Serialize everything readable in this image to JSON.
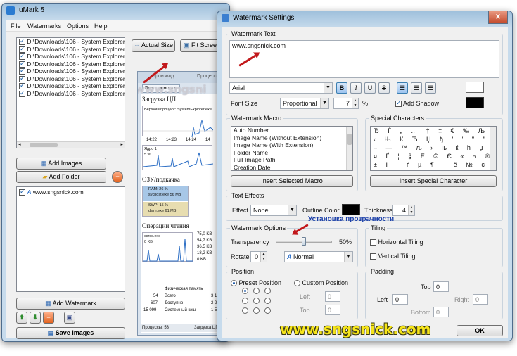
{
  "colors": {
    "accent": "#3c7fb1",
    "annotation_red": "#c2181b",
    "annotation_blue": "#1a3ea8",
    "watermark_yellow": "#f6e51b"
  },
  "umark": {
    "title": "uMark 5",
    "menu": [
      "File",
      "Watermarks",
      "Options",
      "Help"
    ],
    "files": [
      "D:\\Downloads\\106 - System Explorer 5",
      "D:\\Downloads\\106 - System Explorer 5",
      "D:\\Downloads\\106 - System Explorer 5",
      "D:\\Downloads\\106 - System Explorer 5",
      "D:\\Downloads\\106 - System Explorer 5",
      "D:\\Downloads\\106 - System Explorer 5",
      "D:\\Downloads\\106 - System Explorer 5",
      "D:\\Downloads\\106 - System Explorer 5"
    ],
    "actual_size": "Actual Size",
    "fit_screen": "Fit Screen",
    "add_images": "Add Images",
    "add_folder": "Add Folder",
    "watermark_item": "www.sngsnick.com",
    "add_watermark": "Add Watermark",
    "save_images": "Save Images"
  },
  "preview": {
    "tab_perf": "Производ",
    "tab_security": "Безопасность",
    "tab_processes": "Процесс",
    "cpu_title": "Загрузка ЦП",
    "top_process": "Верхний процесс: SystemExplorer.exe",
    "cpu_times": [
      "14:22",
      "14:23",
      "14:24",
      "14"
    ],
    "core_label": "Ядро 1",
    "core_pct": "5 %",
    "ram_title": "ОЗУ/подкачка",
    "ram_line": "RAM: 26 %",
    "ram_proc": "svchost.exe 56 MB",
    "swp_line": "SWP: 15 %",
    "swp_proc": "dwm.exe 61 MB",
    "read_title": "Операции чтения",
    "read_proc": "csrss.exe",
    "read_kb": "0 KB",
    "read_vals": [
      "75,0 KB",
      "54,7 KB",
      "36,5 KB",
      "18,2 KB",
      "0 KB"
    ],
    "phys_header": "Физическая память",
    "phys_rows": [
      {
        "num": "54",
        "label": "Всего",
        "val": "3 1"
      },
      {
        "num": "607",
        "label": "Доступно",
        "val": "2 2"
      },
      {
        "num": "15 099",
        "label": "Системный кэш",
        "val": "1 5"
      }
    ],
    "status_processes": "Процессы: 53",
    "status_load": "Загрузка ЦП"
  },
  "dialog": {
    "title": "Watermark Settings",
    "watermark_text_label": "Watermark Text",
    "watermark_text": "www.sngsnick.com",
    "font": "Arial",
    "fmt_bold": "B",
    "fmt_italic": "I",
    "fmt_underline": "U",
    "fmt_strike": "S",
    "font_size_label": "Font Size",
    "font_size_mode": "Proportional",
    "font_size_value": "7",
    "font_size_unit": "%",
    "add_shadow": "Add Shadow",
    "macro_label": "Watermark Macro",
    "macros": [
      "Auto Number",
      "Image Name (Without Extension)",
      "Image Name (With Extension)",
      "Folder Name",
      "Full Image Path",
      "Creation Date"
    ],
    "insert_macro": "Insert Selected Macro",
    "special_label": "Special Characters",
    "special_rows": [
      "Ђ Ѓ „ … † ‡ € ‰ Љ",
      "‹ Њ Ќ Ћ Џ ђ ' ' \" \" •",
      "– — ™ љ › њ ќ ћ џ Ў ў Ј",
      "¤ Ґ ¦ § Ё © Є « ¬ ® Ї °",
      "± І і ґ µ ¶ · ё № є » ј"
    ],
    "insert_special": "Insert Special Character",
    "text_effects_label": "Text Effects",
    "effect_label": "Effect",
    "effect_value": "None",
    "outline_color_label": "Outline Color",
    "thickness_label": "Thickness",
    "thickness_value": "4",
    "wm_options_label": "Watermark Options",
    "transparency_label": "Transparency",
    "transparency_pct": "50%",
    "transparency_value": 0.5,
    "rotate_label": "Rotate",
    "rotate_value": "0",
    "blend_mode": "Normal",
    "tiling_label": "Tiling",
    "horizontal_tiling": "Horizontal Tiling",
    "vertical_tiling": "Vertical Tiling",
    "position_label": "Position",
    "preset_position": "Preset Position",
    "custom_position": "Custom Position",
    "pos_left_label": "Left",
    "pos_top_label": "Top",
    "pos_left_value": "0",
    "pos_top_value": "0",
    "padding_label": "Padding",
    "pad_top_label": "Top",
    "pad_left_label": "Left",
    "pad_right_label": "Right",
    "pad_bottom_label": "Bottom",
    "pad_top": "0",
    "pad_left": "0",
    "pad_right": "0",
    "pad_bottom": "0",
    "ok": "OK"
  },
  "annotation_transparency": "Установка прозрачности",
  "watermark_overlay": "www.sngsnick.com",
  "watermark_ghost": "www.sngsni"
}
